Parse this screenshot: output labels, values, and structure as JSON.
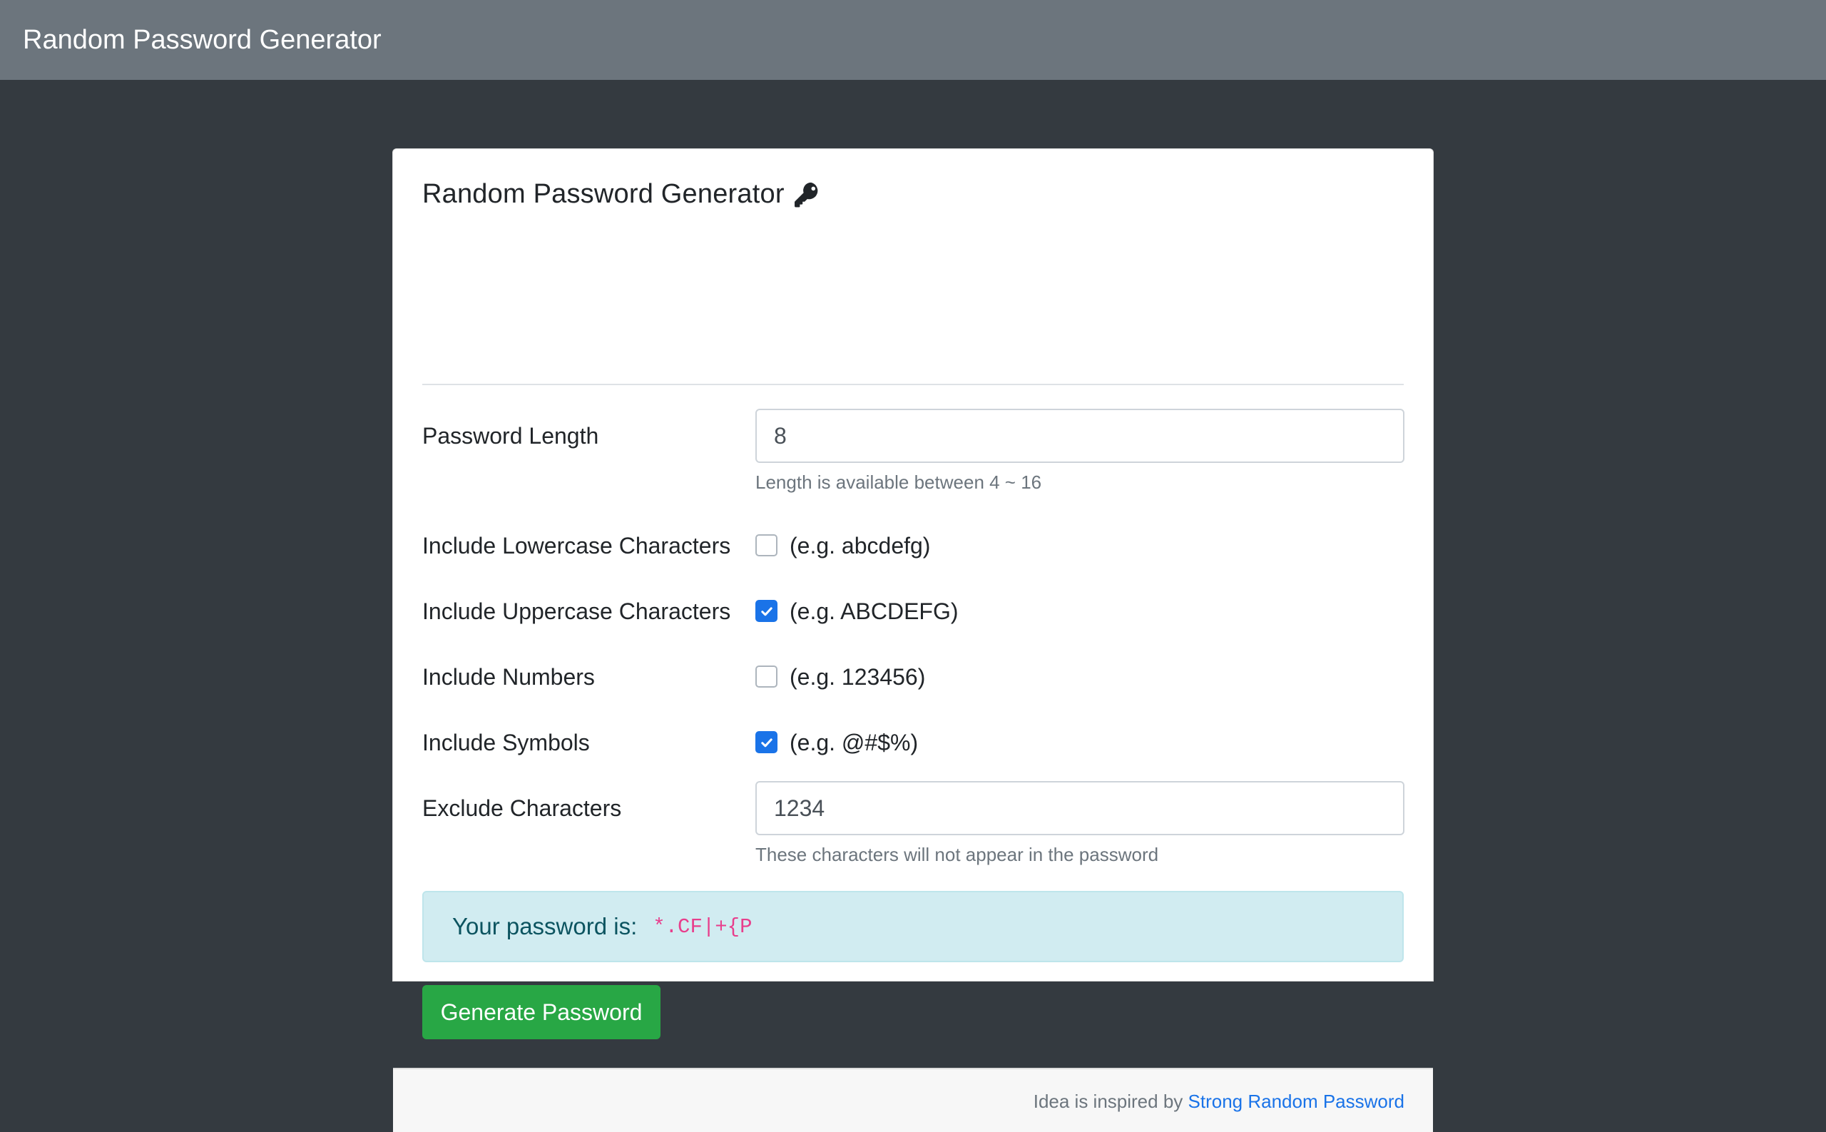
{
  "navbar": {
    "brand": "Random Password Generator"
  },
  "card": {
    "title": "Random Password Generator",
    "title_icon": "key-icon",
    "length": {
      "label": "Password Length",
      "value": "8",
      "help": "Length is available between 4 ~ 16"
    },
    "options": [
      {
        "label": "Include Lowercase Characters",
        "example": "(e.g. abcdefg)",
        "checked": false
      },
      {
        "label": "Include Uppercase Characters",
        "example": "(e.g. ABCDEFG)",
        "checked": true
      },
      {
        "label": "Include Numbers",
        "example": "(e.g. 123456)",
        "checked": false
      },
      {
        "label": "Include Symbols",
        "example": "(e.g. @#$%)",
        "checked": true
      }
    ],
    "exclude": {
      "label": "Exclude Characters",
      "value": "1234",
      "help": "These characters will not appear in the password"
    },
    "result": {
      "label": "Your password is:",
      "password": "*.CF|+{P"
    },
    "generate_button": "Generate Password",
    "footer": {
      "text": "Idea is inspired by",
      "link": "Strong Random Password"
    }
  },
  "colors": {
    "navbar_bg": "#6c757d",
    "page_bg": "#343a40",
    "checkbox_checked": "#1a73e8",
    "button_bg": "#28a745",
    "alert_bg": "#d1ecf1",
    "password_text": "#e83e8c"
  }
}
